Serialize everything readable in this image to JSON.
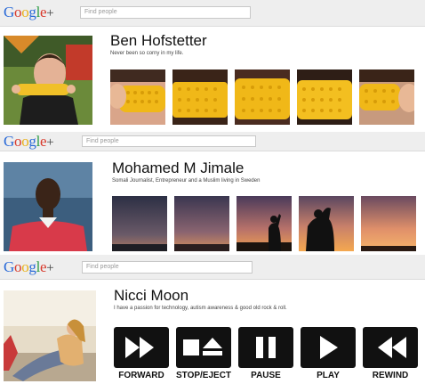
{
  "brand": {
    "g": "G",
    "o1": "o",
    "o2": "o",
    "g2": "g",
    "l": "l",
    "e": "e",
    "plus": "+"
  },
  "profiles": [
    {
      "search_placeholder": "Find people",
      "name": "Ben Hofstetter",
      "tagline": "Never been so corny in my life."
    },
    {
      "search_placeholder": "Find people",
      "name": "Mohamed M Jimale",
      "tagline": "Somali Journalist, Entrepreneur and a Muslim living in Sweden"
    },
    {
      "search_placeholder": "Find people",
      "name": "Nicci Moon",
      "tagline": "I have a passion for technology, autism awareness & good old rock & roll."
    }
  ],
  "media_controls": [
    {
      "label": "FORWARD",
      "icon": "fast-forward-icon"
    },
    {
      "label": "STOP/EJECT",
      "icon": "stop-eject-icon"
    },
    {
      "label": "PAUSE",
      "icon": "pause-icon"
    },
    {
      "label": "PLAY",
      "icon": "play-icon"
    },
    {
      "label": "REWIND",
      "icon": "rewind-icon"
    }
  ],
  "colors": {
    "corn": "#f0b818",
    "sunset_top": "#2b2b40",
    "sunset_bottom": "#e88a48",
    "header_bar": "#eeeeee"
  }
}
